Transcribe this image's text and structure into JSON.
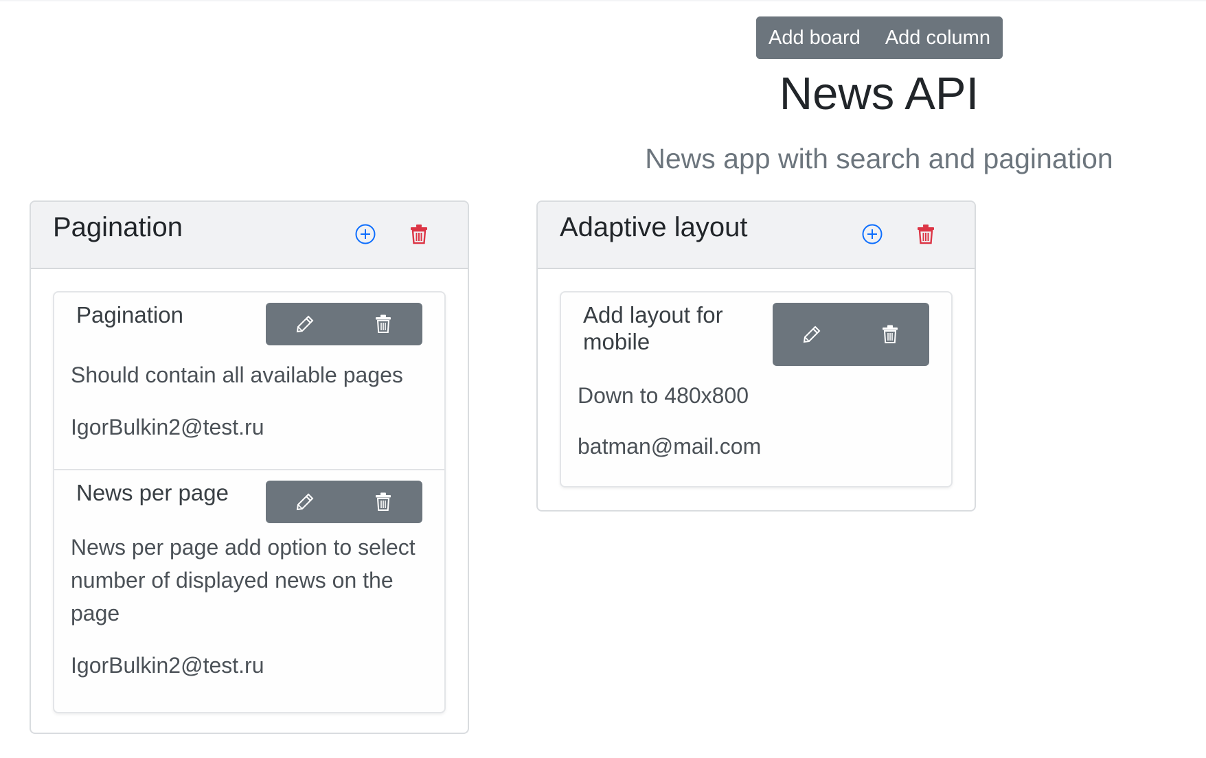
{
  "toolbar": {
    "add_board_label": "Add board",
    "add_column_label": "Add column"
  },
  "header": {
    "title": "News API",
    "subtitle": "News app with search and pagination"
  },
  "columns": [
    {
      "title": "Pagination",
      "add_icon": "plus-circle-icon",
      "delete_icon": "trash-icon",
      "tasks": [
        {
          "title": "Pagination",
          "description": "Should contain all available pages",
          "email": "IgorBulkin2@test.ru",
          "edit_icon": "pencil-icon",
          "delete_icon": "trash-icon"
        },
        {
          "title": "News per page",
          "description": "News per page add option to select number of displayed news on the page",
          "email": "IgorBulkin2@test.ru",
          "edit_icon": "pencil-icon",
          "delete_icon": "trash-icon"
        }
      ]
    },
    {
      "title": "Adaptive layout",
      "add_icon": "plus-circle-icon",
      "delete_icon": "trash-icon",
      "tasks": [
        {
          "title": "Add layout for mobile",
          "description": "Down to 480x800",
          "email": "batman@mail.com",
          "edit_icon": "pencil-icon",
          "delete_icon": "trash-icon"
        }
      ]
    }
  ],
  "colors": {
    "secondary_button": "#6c757d",
    "add_icon": "#0d6efd",
    "delete_icon": "#dc3545",
    "subtitle": "#6c757d",
    "header_bg": "#f1f2f4"
  }
}
